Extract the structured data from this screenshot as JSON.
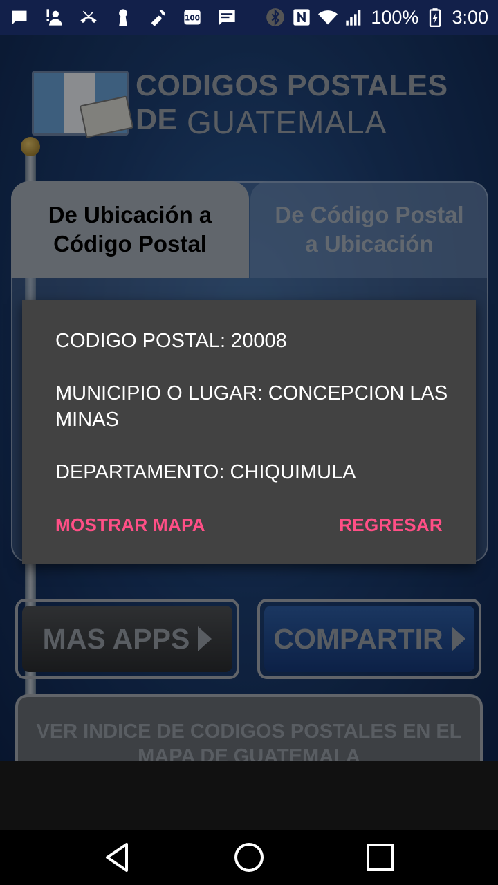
{
  "status_bar": {
    "battery": "100%",
    "time": "3:00",
    "icons": [
      "chat-bubble-icon",
      "alert-person-icon",
      "missed-call-icon",
      "keyhole-icon",
      "wrench-icon",
      "badge-100-icon",
      "message-icon",
      "bluetooth-icon",
      "nfc-icon",
      "wifi-icon",
      "signal-icon",
      "battery-icon"
    ]
  },
  "header": {
    "title_line1": "CODIGOS POSTALES DE",
    "title_line2": "GUATEMALA"
  },
  "tabs": [
    {
      "label": "De Ubicación a\nCódigo Postal",
      "active": true
    },
    {
      "label": "De Código Postal\na Ubicación",
      "active": false
    }
  ],
  "buttons": {
    "mas_apps": "MAS APPS",
    "compartir": "COMPARTIR",
    "ver_indice": "VER INDICE DE CODIGOS POSTALES EN EL MAPA DE GUATEMALA"
  },
  "dialog": {
    "codigo_postal": "CODIGO POSTAL: 20008",
    "municipio": "MUNICIPIO O LUGAR: CONCEPCION LAS MINAS",
    "departamento": "DEPARTAMENTO: CHIQUIMULA",
    "show_map_label": "MOSTRAR MAPA",
    "back_label": "REGRESAR"
  },
  "nav_bar": {
    "icons": [
      "back-icon",
      "home-icon",
      "recents-icon"
    ]
  },
  "colors": {
    "dialog_bg": "#424242",
    "dialog_accent": "#ff4f86",
    "status_bar": "#12204a"
  }
}
